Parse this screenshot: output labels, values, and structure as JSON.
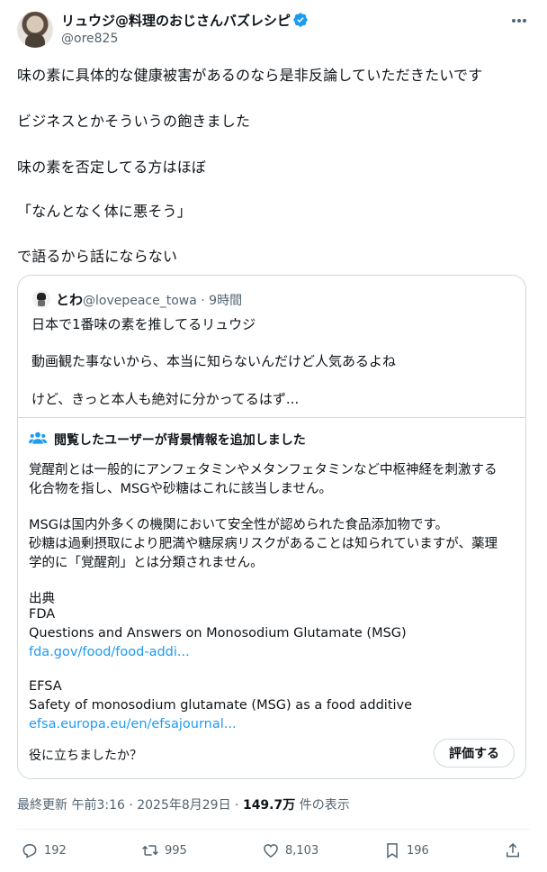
{
  "author": {
    "display_name": "リュウジ@料理のおじさんバズレシピ",
    "handle": "@ore825"
  },
  "tweet_lines": [
    "味の素に具体的な健康被害があるのなら是非反論していただきたいです",
    "ビジネスとかそういうの飽きました",
    "味の素を否定してる方はほぼ",
    "「なんとなく体に悪そう」",
    "で語るから話にならない"
  ],
  "quote": {
    "name": "とわ",
    "handle_time": "@lovepeace_towa · 9時間",
    "lines": [
      "日本で1番味の素を推してるリュウジ",
      "動画観た事ないから、本当に知らないんだけど人気あるよね",
      "けど、きっと本人も絶対に分かってるはず..."
    ]
  },
  "community_note": {
    "title": "閲覧したユーザーが背景情報を追加しました",
    "paragraph1": [
      "覚醒剤とは一般的にアンフェタミンやメタンフェタミンなど中枢神経を刺激する",
      "化合物を指し、MSGや砂糖はこれに該当しません。"
    ],
    "paragraph2": [
      "MSGは国内外多くの機関において安全性が認められた食品添加物です。",
      "砂糖は過剰摂取により肥満や糖尿病リスクがあることは知られていますが、薬理",
      "学的に「覚醒剤」とは分類されません。"
    ],
    "sources_label": "出典",
    "source1_org": "FDA",
    "source1_title": "Questions and Answers on Monosodium Glutamate (MSG)",
    "source1_link": "fda.gov/food/food-addi...",
    "source2_org": "EFSA",
    "source2_title": "Safety of monosodium glutamate (MSG) as a food additive",
    "source2_link": "efsa.europa.eu/en/efsajournal...",
    "helpful_question": "役に立ちましたか？",
    "rate_label": "評価する"
  },
  "meta": {
    "updated": "最終更新 午前3:16 · 2025年8月29日 · ",
    "views": "149.7万",
    "views_suffix": " 件の表示"
  },
  "actions": {
    "replies": "192",
    "reposts": "995",
    "likes": "8,103",
    "bookmarks": "196"
  },
  "colors": {
    "text": "#0f1419",
    "secondary": "#536471",
    "link": "#1d9bf0",
    "border": "#cfd9de",
    "verified": "#1d9bf0"
  }
}
